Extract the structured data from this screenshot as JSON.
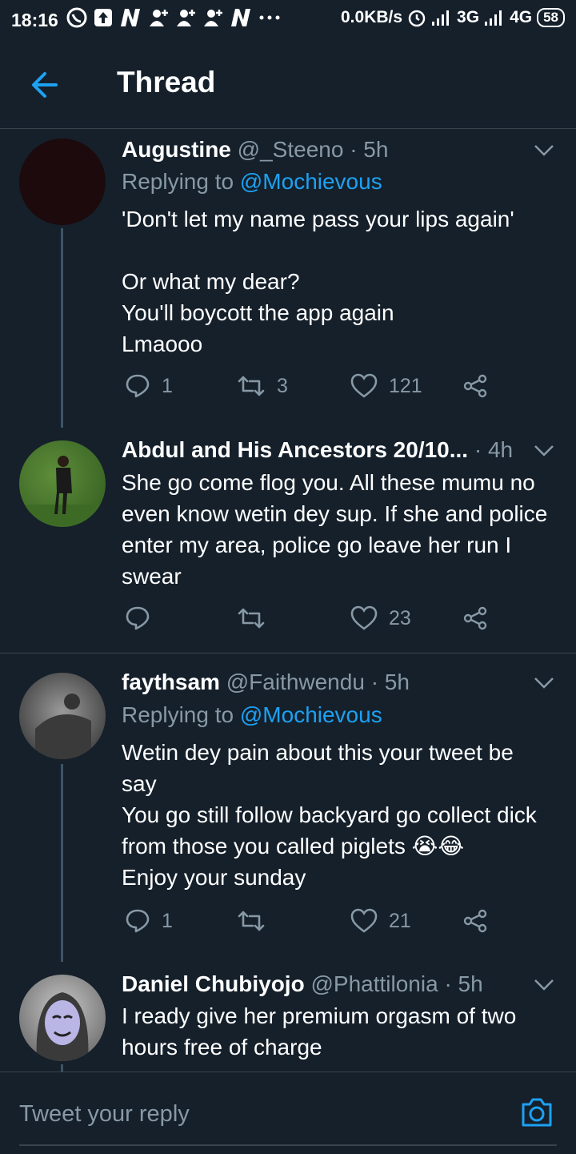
{
  "status_bar": {
    "time": "18:16",
    "net_speed": "0.0KB/s",
    "net1": "3G",
    "net2": "4G",
    "battery": "58"
  },
  "header": {
    "title": "Thread",
    "back_icon": "arrow-left-icon"
  },
  "colors": {
    "background": "#15202b",
    "accent": "#1da1f2",
    "muted": "#8899a6",
    "divider": "#38444d"
  },
  "tweets": [
    {
      "name": "Augustine",
      "handle": "@_Steeno",
      "time": "· 5h",
      "replying_prefix": "Replying to",
      "replying_to": "@Mochievous",
      "text": "'Don't let my name pass your lips again'\n\nOr what my dear?\nYou'll boycott the app again\nLmaooo",
      "replies": "1",
      "retweets": "3",
      "likes": "121"
    },
    {
      "name": "Abdul and His Ancestors 20/10...",
      "handle": "",
      "time": "· 4h",
      "text": "She go come flog you. All these mumu no even know wetin dey sup. If she and police enter my area, police go leave her run I swear",
      "replies": "",
      "retweets": "",
      "likes": "23"
    },
    {
      "name": "faythsam",
      "handle": "@Faithwendu",
      "time": "· 5h",
      "replying_prefix": "Replying to",
      "replying_to": "@Mochievous",
      "text": "Wetin dey pain about this your tweet be say\nYou go still follow backyard go collect dick from those you called piglets 😭😂\nEnjoy your sunday",
      "replies": "1",
      "retweets": "",
      "likes": "21"
    },
    {
      "name": "Daniel Chubiyojo",
      "handle": "@Phattilonia",
      "time": "· 5h",
      "text": "I ready give her premium orgasm of two hours free of charge"
    }
  ],
  "composer": {
    "placeholder": "Tweet your reply",
    "camera_icon": "camera-icon"
  }
}
